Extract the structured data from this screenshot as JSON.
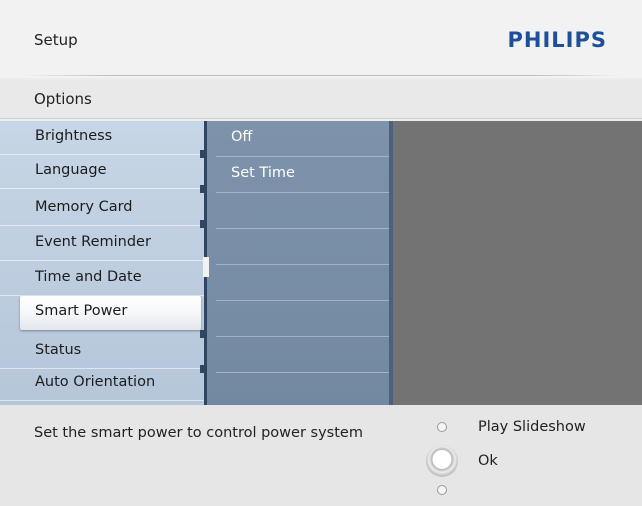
{
  "header": {
    "title": "Setup",
    "brand": "PHILIPS"
  },
  "options_bar": {
    "label": "Options"
  },
  "menu": {
    "items": [
      {
        "label": "Brightness"
      },
      {
        "label": "Language"
      },
      {
        "label": "Memory Card"
      },
      {
        "label": "Event Reminder"
      },
      {
        "label": "Time and Date"
      },
      {
        "label": "Smart Power"
      },
      {
        "label": "Status"
      },
      {
        "label": "Auto Orientation"
      }
    ],
    "selected": "Smart Power"
  },
  "submenu": {
    "items": [
      {
        "label": "Off"
      },
      {
        "label": "Set Time"
      }
    ]
  },
  "footer": {
    "help_text": "Set the smart power to control power system",
    "play_label": "Play Slideshow",
    "ok_label": "Ok"
  }
}
